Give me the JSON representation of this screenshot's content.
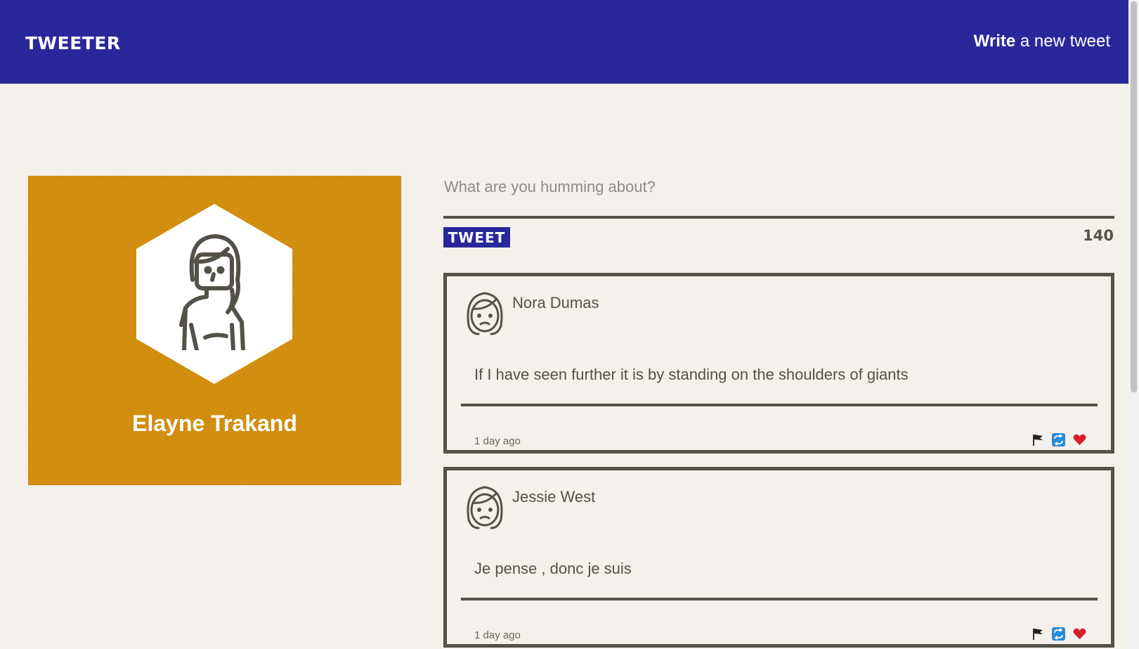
{
  "nav": {
    "brand": "TWEETER",
    "compose_bold": "Write",
    "compose_rest": " a new tweet"
  },
  "profile": {
    "name": "Elayne Trakand",
    "avatar_icon": "woman-avatar-icon",
    "background_color": "#d58f0a"
  },
  "composer": {
    "placeholder": "What are you humming about?",
    "button_label": "TWEET",
    "counter": "140"
  },
  "tweets": [
    {
      "author": "Nora Dumas",
      "text": "If I have seen further it is by standing on the shoulders of giants",
      "time": "1 day ago"
    },
    {
      "author": "Jessie West",
      "text": "Je pense , donc je suis",
      "time": "1 day ago"
    }
  ],
  "actions": [
    "flag-icon",
    "retweet-icon",
    "heart-icon"
  ],
  "colors": {
    "accent": "#29289a",
    "text": "#545149",
    "background": "#f4f1ec"
  }
}
